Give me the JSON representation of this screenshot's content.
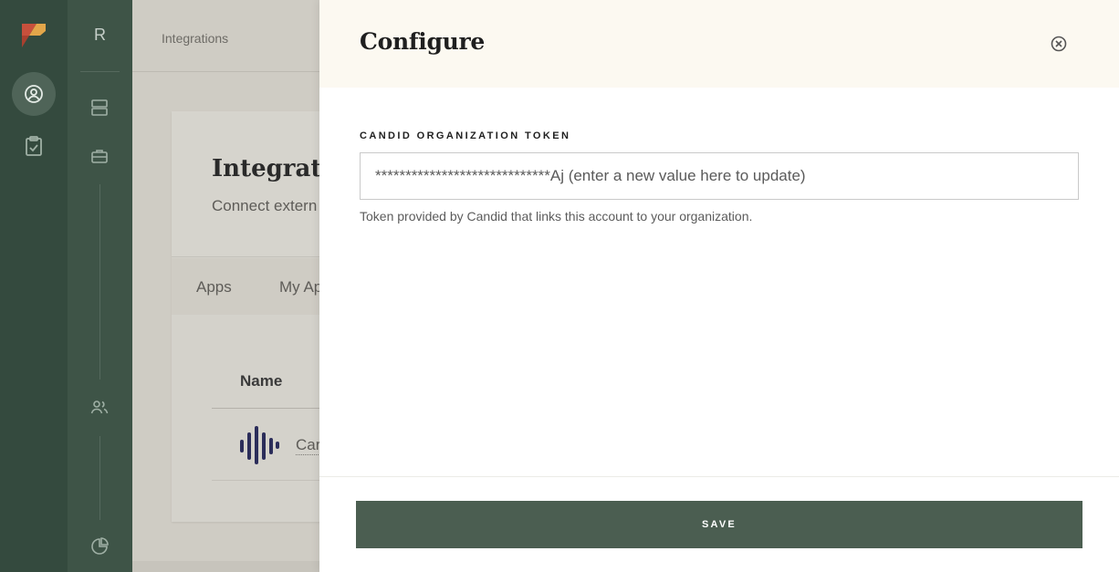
{
  "rail": {
    "icons": [
      "logo-icon",
      "user-search-icon",
      "clipboard-check-icon"
    ]
  },
  "rail2": {
    "letter": "R",
    "icons": [
      "database-icon",
      "briefcase-icon",
      "users-icon",
      "pie-chart-icon"
    ]
  },
  "background": {
    "breadcrumb": "Integrations",
    "card_title": "Integration",
    "card_subtitle": "Connect extern",
    "tabs": [
      "Apps",
      "My Ap"
    ],
    "table_header": "Name",
    "app_name": "Car"
  },
  "drawer": {
    "title": "Configure",
    "field": {
      "label": "CANDID ORGANIZATION TOKEN",
      "placeholder": "*****************************Aj (enter a new value here to update)",
      "value": "",
      "help": "Token provided by Candid that links this account to your organization."
    },
    "save_label": "SAVE"
  },
  "colors": {
    "rail": "#344a3e",
    "rail_secondary": "#3e5447",
    "header_bg": "#fcf9f1",
    "save_button": "#4b5e51",
    "logo_red": "#c8503c",
    "logo_gold": "#e3a64a"
  }
}
